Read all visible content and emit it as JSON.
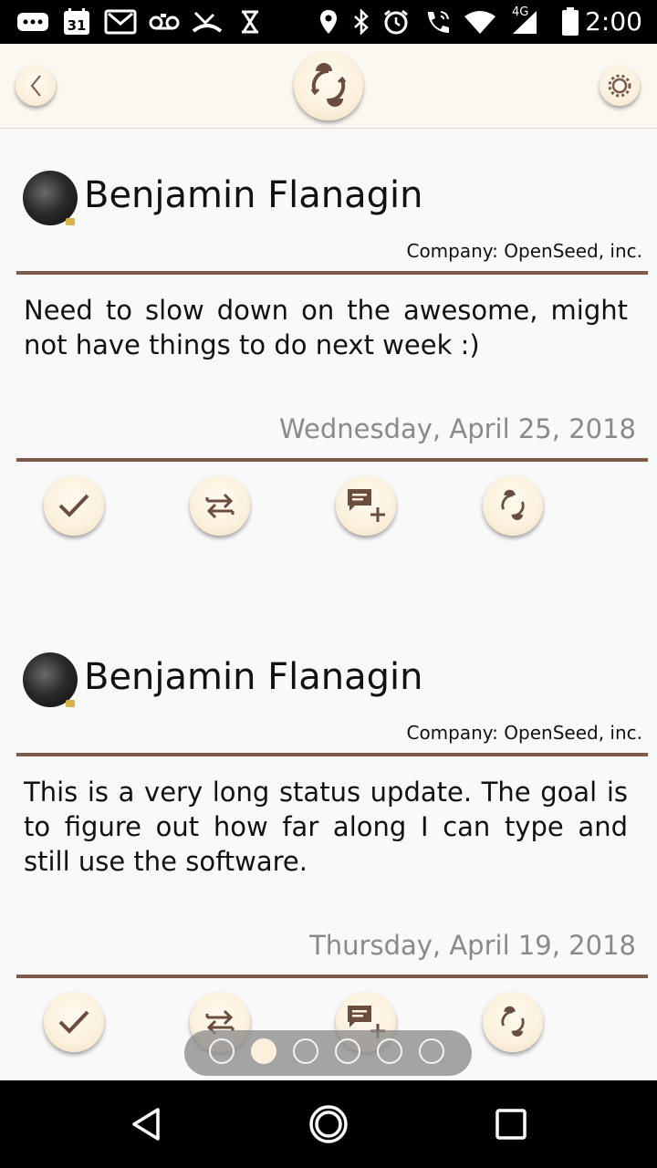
{
  "status_bar": {
    "time": "2:00",
    "network": "4G",
    "calendar_day": "31",
    "left_icons": [
      "more-icon",
      "calendar-icon",
      "gmail-icon",
      "voicemail-icon",
      "missed-call-icon",
      "hourglass-icon"
    ],
    "right_icons": [
      "location-icon",
      "bluetooth-icon",
      "alarm-icon",
      "call-icon",
      "wifi-icon",
      "signal-icon",
      "battery-icon"
    ]
  },
  "header": {
    "back_icon": "chevron-left-icon",
    "logo_icon": "app-logo-icon",
    "settings_icon": "gear-icon"
  },
  "posts": [
    {
      "author": "Benjamin Flanagin",
      "company": "Company: OpenSeed, inc.",
      "text": "Need to slow down on the awesome, might not have things to do next week :)",
      "date": "Wednesday, April 25, 2018",
      "actions": [
        "check-icon",
        "repost-icon",
        "add-comment-icon",
        "app-logo-icon"
      ]
    },
    {
      "author": "Benjamin Flanagin",
      "company": "Company: OpenSeed, inc.",
      "text": "This is a very long status update. The goal is to figure out how far along I can type and still use the software.",
      "date": "Thursday, April 19, 2018",
      "actions": [
        "check-icon",
        "repost-icon",
        "add-comment-icon",
        "app-logo-icon"
      ]
    }
  ],
  "pager": {
    "count": 6,
    "active_index": 1
  },
  "nav": [
    "back-icon",
    "home-icon",
    "recents-icon"
  ],
  "colors": {
    "accent": "#7b5a4c",
    "button_bg": "#fbf0dc",
    "header_bg": "#fbf8f1"
  }
}
